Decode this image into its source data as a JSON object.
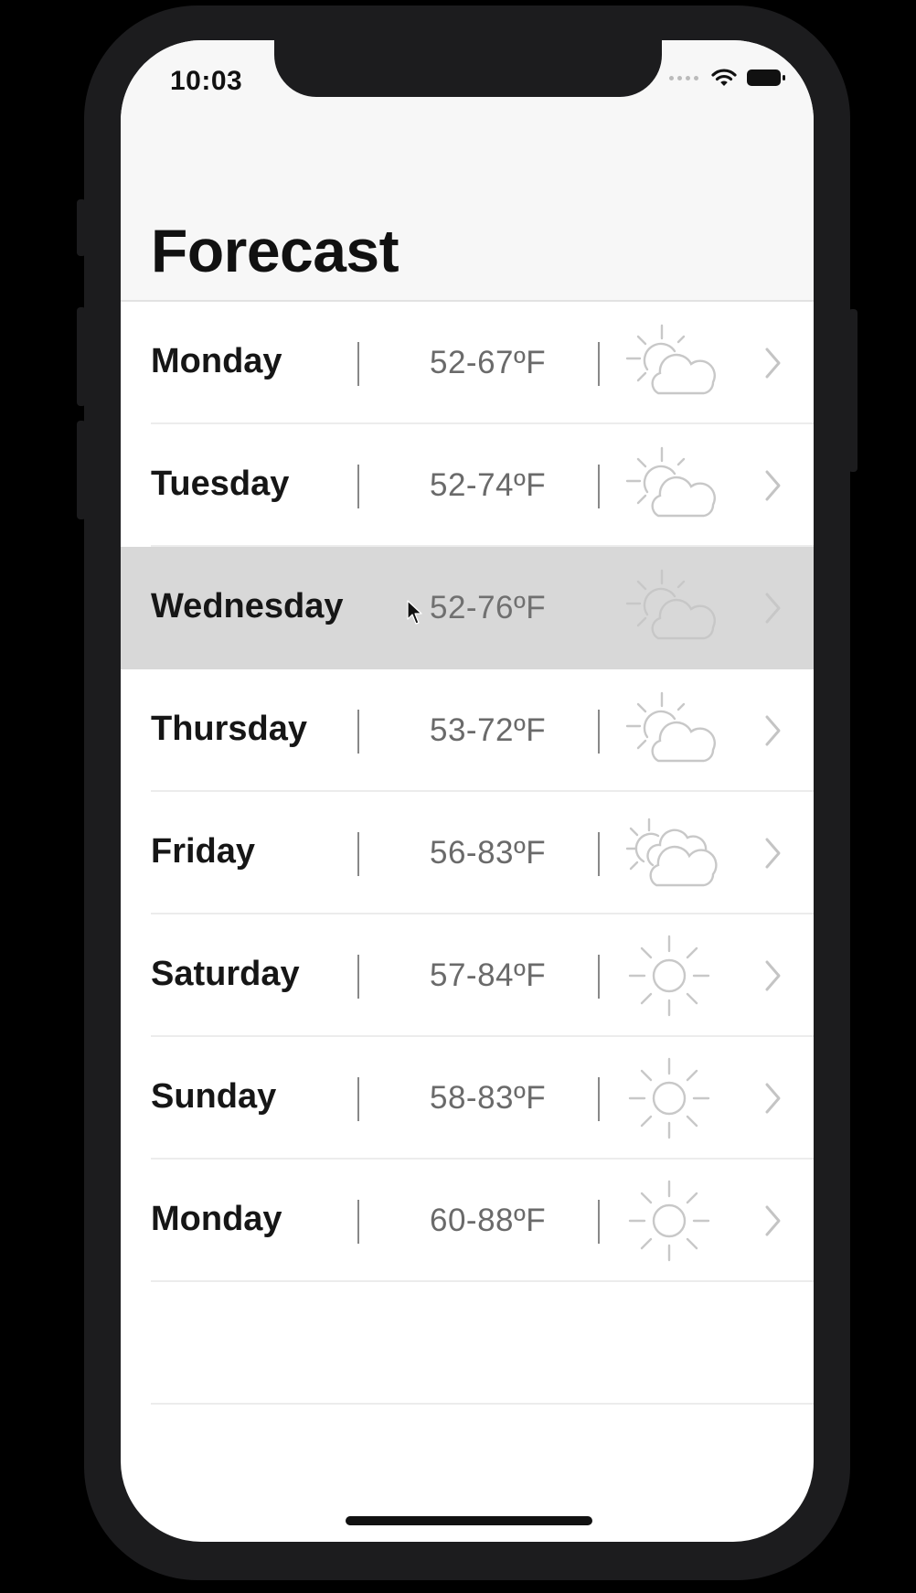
{
  "status_bar": {
    "time": "10:03",
    "icons": [
      "signal-dots-icon",
      "wifi-icon",
      "battery-icon"
    ]
  },
  "header": {
    "title": "Forecast"
  },
  "forecast": {
    "rows": [
      {
        "day": "Monday",
        "temp": "52-67ºF",
        "icon": "partly-cloudy-icon",
        "selected": false
      },
      {
        "day": "Tuesday",
        "temp": "52-74ºF",
        "icon": "partly-cloudy-icon",
        "selected": false
      },
      {
        "day": "Wednesday",
        "temp": "52-76ºF",
        "icon": "partly-cloudy-icon",
        "selected": true
      },
      {
        "day": "Thursday",
        "temp": "53-72ºF",
        "icon": "partly-cloudy-icon",
        "selected": false
      },
      {
        "day": "Friday",
        "temp": "56-83ºF",
        "icon": "mostly-cloudy-icon",
        "selected": false
      },
      {
        "day": "Saturday",
        "temp": "57-84ºF",
        "icon": "sun-icon",
        "selected": false
      },
      {
        "day": "Sunday",
        "temp": "58-83ºF",
        "icon": "sun-icon",
        "selected": false
      },
      {
        "day": "Monday",
        "temp": "60-88ºF",
        "icon": "sun-icon",
        "selected": false
      }
    ]
  },
  "colors": {
    "background": "#000000",
    "device": "#1c1c1e",
    "screen": "#ffffff",
    "nav_bar": "#f7f7f7",
    "selected_row": "#d8d8d8",
    "icon_stroke": "#c8c8c8"
  }
}
